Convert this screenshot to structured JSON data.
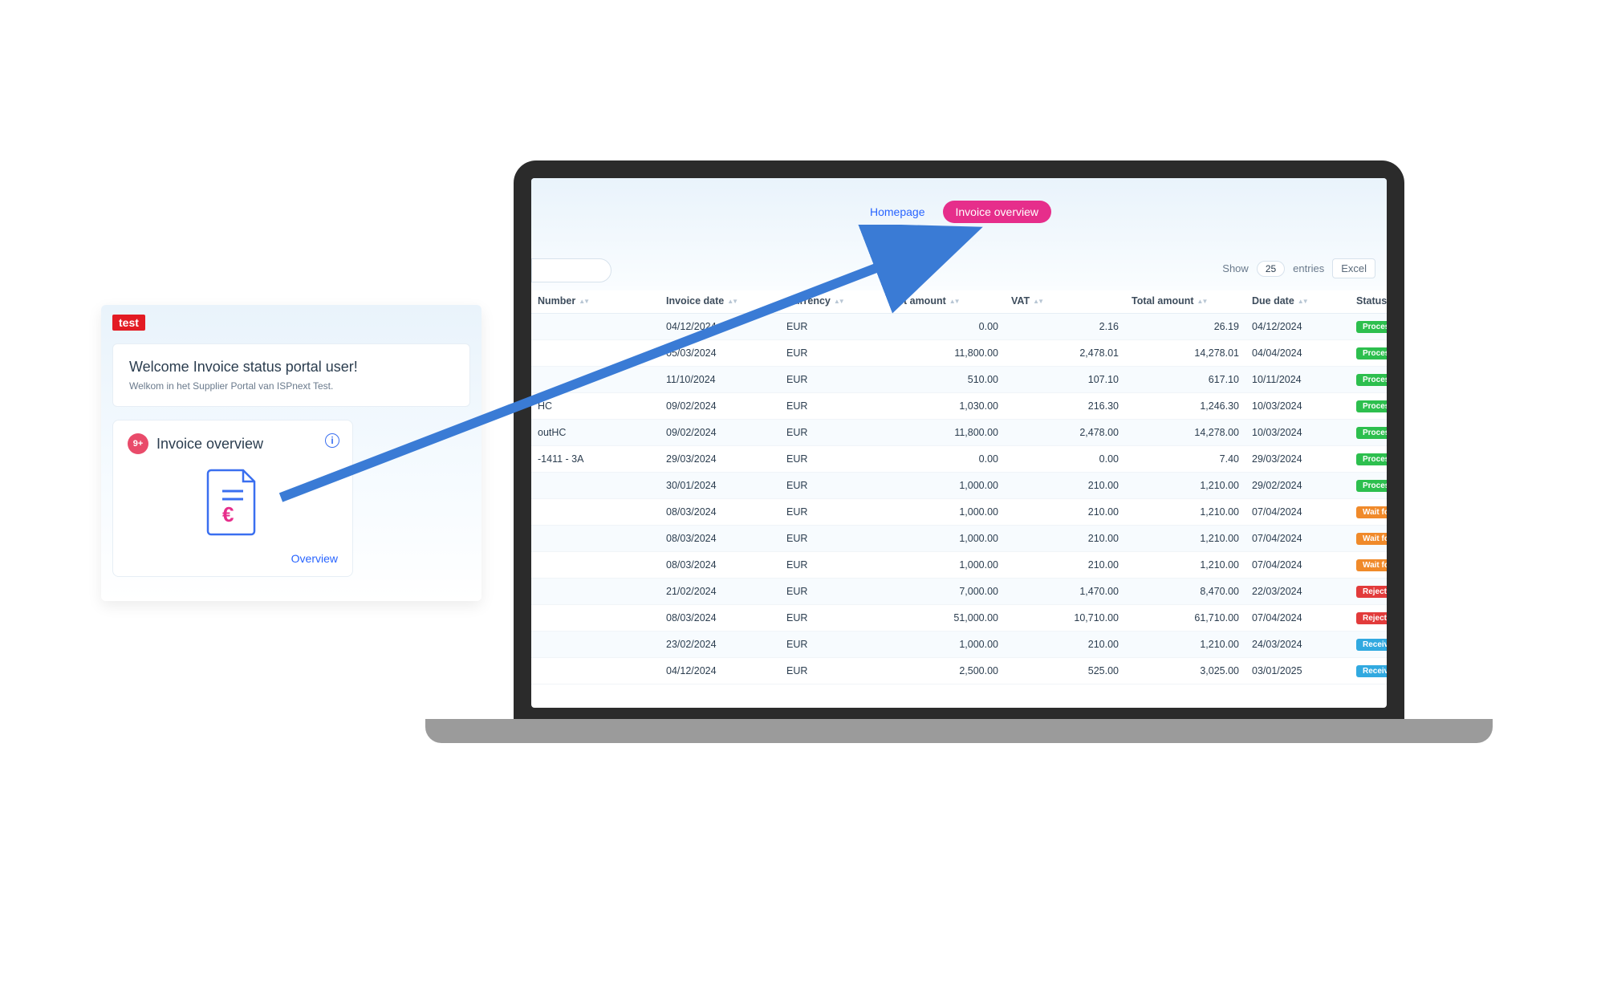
{
  "popup": {
    "logo_text": "test",
    "welcome_title": "Welcome Invoice status portal user!",
    "welcome_sub": "Welkom in het Supplier Portal van ISPnext Test.",
    "tile_badge": "9+",
    "tile_title": "Invoice overview",
    "tile_link": "Overview"
  },
  "tabs": {
    "home": "Homepage",
    "invoice": "Invoice overview"
  },
  "toolbar": {
    "show_label": "Show",
    "entries_label": "entries",
    "entries_value": "25",
    "excel_label": "Excel"
  },
  "columns": {
    "number": "Number",
    "invoice_date": "Invoice date",
    "currency": "Currency",
    "net_amount": "Net amount",
    "vat": "VAT",
    "total_amount": "Total amount",
    "due_date": "Due date",
    "status": "Status"
  },
  "status_labels": {
    "processed": "Processed",
    "wait": "Wait for DD",
    "rejected": "Rejected",
    "received": "Received"
  },
  "rows": [
    {
      "number": "",
      "invoice_date": "04/12/2024",
      "currency": "EUR",
      "net": "0.00",
      "vat": "2.16",
      "total": "26.19",
      "due": "04/12/2024",
      "status": "processed"
    },
    {
      "number": "",
      "invoice_date": "05/03/2024",
      "currency": "EUR",
      "net": "11,800.00",
      "vat": "2,478.01",
      "total": "14,278.01",
      "due": "04/04/2024",
      "status": "processed"
    },
    {
      "number": "",
      "invoice_date": "11/10/2024",
      "currency": "EUR",
      "net": "510.00",
      "vat": "107.10",
      "total": "617.10",
      "due": "10/11/2024",
      "status": "processed"
    },
    {
      "number": "HC",
      "invoice_date": "09/02/2024",
      "currency": "EUR",
      "net": "1,030.00",
      "vat": "216.30",
      "total": "1,246.30",
      "due": "10/03/2024",
      "status": "processed"
    },
    {
      "number": "outHC",
      "invoice_date": "09/02/2024",
      "currency": "EUR",
      "net": "11,800.00",
      "vat": "2,478.00",
      "total": "14,278.00",
      "due": "10/03/2024",
      "status": "processed"
    },
    {
      "number": "-1411 - 3A",
      "invoice_date": "29/03/2024",
      "currency": "EUR",
      "net": "0.00",
      "vat": "0.00",
      "total": "7.40",
      "due": "29/03/2024",
      "status": "processed"
    },
    {
      "number": "",
      "invoice_date": "30/01/2024",
      "currency": "EUR",
      "net": "1,000.00",
      "vat": "210.00",
      "total": "1,210.00",
      "due": "29/02/2024",
      "status": "processed"
    },
    {
      "number": "",
      "invoice_date": "08/03/2024",
      "currency": "EUR",
      "net": "1,000.00",
      "vat": "210.00",
      "total": "1,210.00",
      "due": "07/04/2024",
      "status": "wait"
    },
    {
      "number": "",
      "invoice_date": "08/03/2024",
      "currency": "EUR",
      "net": "1,000.00",
      "vat": "210.00",
      "total": "1,210.00",
      "due": "07/04/2024",
      "status": "wait"
    },
    {
      "number": "",
      "invoice_date": "08/03/2024",
      "currency": "EUR",
      "net": "1,000.00",
      "vat": "210.00",
      "total": "1,210.00",
      "due": "07/04/2024",
      "status": "wait"
    },
    {
      "number": "",
      "invoice_date": "21/02/2024",
      "currency": "EUR",
      "net": "7,000.00",
      "vat": "1,470.00",
      "total": "8,470.00",
      "due": "22/03/2024",
      "status": "rejected"
    },
    {
      "number": "",
      "invoice_date": "08/03/2024",
      "currency": "EUR",
      "net": "51,000.00",
      "vat": "10,710.00",
      "total": "61,710.00",
      "due": "07/04/2024",
      "status": "rejected"
    },
    {
      "number": "",
      "invoice_date": "23/02/2024",
      "currency": "EUR",
      "net": "1,000.00",
      "vat": "210.00",
      "total": "1,210.00",
      "due": "24/03/2024",
      "status": "received"
    },
    {
      "number": "",
      "invoice_date": "04/12/2024",
      "currency": "EUR",
      "net": "2,500.00",
      "vat": "525.00",
      "total": "3,025.00",
      "due": "03/01/2025",
      "status": "received"
    }
  ]
}
